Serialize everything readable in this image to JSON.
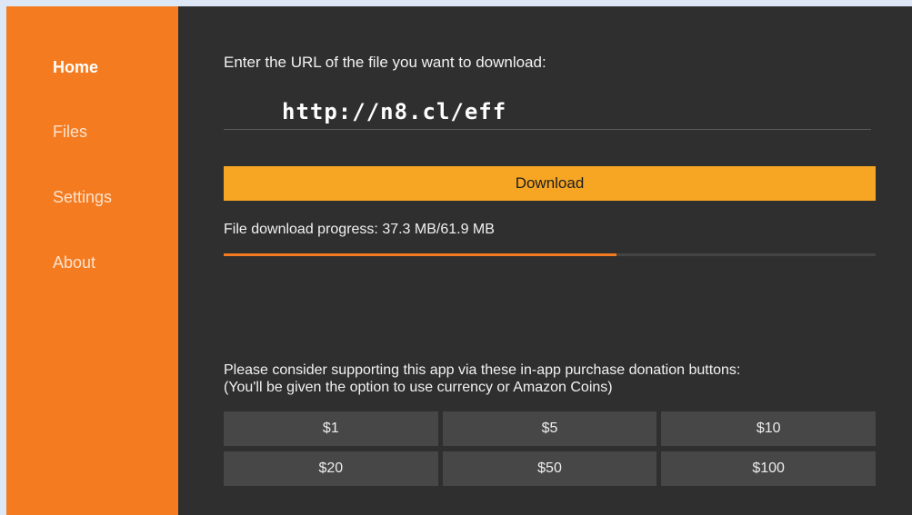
{
  "sidebar": {
    "items": [
      {
        "label": "Home",
        "active": true
      },
      {
        "label": "Files",
        "active": false
      },
      {
        "label": "Settings",
        "active": false
      },
      {
        "label": "About",
        "active": false
      }
    ]
  },
  "main": {
    "url_prompt": "Enter the URL of the file you want to download:",
    "url_value": "http://n8.cl/eff",
    "download_label": "Download",
    "progress_text": "File download progress: 37.3 MB/61.9 MB",
    "progress_fraction": 0.603,
    "donate_line1": "Please consider supporting this app via these in-app purchase donation buttons:",
    "donate_line2": "(You'll be given the option to use currency or Amazon Coins)",
    "donations": [
      "$1",
      "$5",
      "$10",
      "$20",
      "$50",
      "$100"
    ]
  },
  "colors": {
    "accent_orange": "#f47b20",
    "button_yellow": "#f6a623",
    "background_dark": "#2f2f2f",
    "donate_button": "#474747"
  }
}
